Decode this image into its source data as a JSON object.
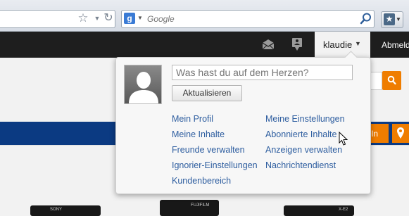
{
  "browser": {
    "search_placeholder": "Google",
    "engine_icon_letter": "g"
  },
  "nav": {
    "username": "klaudie",
    "register_link": "Abmelden"
  },
  "popup": {
    "status_placeholder": "Was hast du auf dem Herzen?",
    "update_button": "Aktualisieren",
    "left_links": [
      "Mein Profil",
      "Meine Inhalte",
      "Freunde verwalten",
      "Ignorier-Einstellungen",
      "Kundenbereich"
    ],
    "right_links": [
      "Meine Einstellungen",
      "Abonnierte Inhalte",
      "Anzeigen verwalten",
      "Nachrichtendienst"
    ]
  },
  "page": {
    "banner_orange_label": "eln",
    "camera_labels": [
      "SONY",
      "FUJIFILM",
      "X-E2"
    ]
  },
  "colors": {
    "accent_orange": "#ef7d00",
    "banner_blue": "#0b3a82",
    "link_blue": "#2d5d9f",
    "nav_dark": "#1e1e1e"
  }
}
